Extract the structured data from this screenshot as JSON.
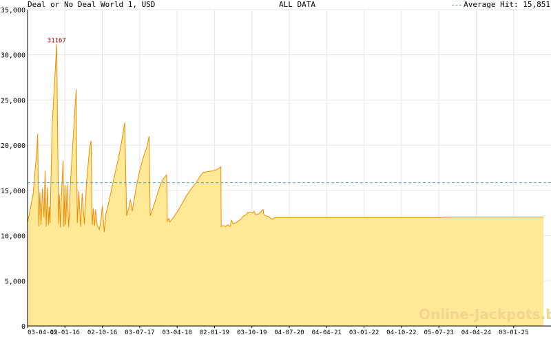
{
  "header": {
    "title": "Deal or No Deal World 1, USD",
    "range": "ALL DATA",
    "average_label": "Average Hit: 15,851"
  },
  "watermark": "Online-Jackpots.biz",
  "colors": {
    "line": "#f08c00",
    "fill": "#ffe896",
    "average_line": "#5aa0c8",
    "peak_label": "#b00000",
    "grid": "#e6e6e6"
  },
  "chart_data": {
    "type": "area",
    "title": "Deal or No Deal World 1, USD",
    "ylim": [
      0,
      35000
    ],
    "y_ticks": [
      0,
      5000,
      10000,
      15000,
      20000,
      25000,
      30000,
      35000
    ],
    "y_tick_labels": [
      "0",
      "5,000",
      "10,000",
      "15,000",
      "20,000",
      "25,000",
      "30,000",
      "35,000"
    ],
    "x_ticks": [
      "03-04-15",
      "02-01-16",
      "02-10-16",
      "03-07-17",
      "03-04-18",
      "02-01-19",
      "03-10-19",
      "04-07-20",
      "04-04-21",
      "03-01-22",
      "04-10-22",
      "05-07-23",
      "04-04-24",
      "03-01-25"
    ],
    "average": 15851,
    "peak": {
      "label": "31167",
      "value": 31167
    },
    "grid": true,
    "series": [
      {
        "points": [
          [
            0,
            11400
          ],
          [
            0.15,
            14600
          ],
          [
            0.25,
            19600
          ],
          [
            0.27,
            21300
          ],
          [
            0.3,
            11000
          ],
          [
            0.33,
            14800
          ],
          [
            0.36,
            11200
          ],
          [
            0.4,
            15200
          ],
          [
            0.44,
            12000
          ],
          [
            0.47,
            17200
          ],
          [
            0.5,
            11000
          ],
          [
            0.53,
            15300
          ],
          [
            0.56,
            11200
          ],
          [
            0.58,
            13200
          ],
          [
            0.6,
            11400
          ],
          [
            0.66,
            22300
          ],
          [
            0.72,
            26800
          ],
          [
            0.78,
            31167
          ],
          [
            0.83,
            11300
          ],
          [
            0.85,
            14600
          ],
          [
            0.88,
            10900
          ],
          [
            0.9,
            14000
          ],
          [
            0.95,
            18300
          ],
          [
            0.97,
            11000
          ],
          [
            1.0,
            15600
          ],
          [
            1.02,
            11200
          ],
          [
            1.06,
            15600
          ],
          [
            1.1,
            10900
          ],
          [
            1.12,
            12500
          ],
          [
            1.15,
            16000
          ],
          [
            1.25,
            22800
          ],
          [
            1.3,
            26200
          ],
          [
            1.33,
            11400
          ],
          [
            1.37,
            14900
          ],
          [
            1.42,
            11000
          ],
          [
            1.46,
            14700
          ],
          [
            1.52,
            11300
          ],
          [
            1.58,
            16000
          ],
          [
            1.66,
            19700
          ],
          [
            1.7,
            20500
          ],
          [
            1.73,
            11200
          ],
          [
            1.76,
            13000
          ],
          [
            1.79,
            11100
          ],
          [
            1.82,
            12900
          ],
          [
            1.86,
            11200
          ],
          [
            1.92,
            10700
          ],
          [
            1.96,
            11600
          ],
          [
            2.0,
            13300
          ],
          [
            2.05,
            10400
          ],
          [
            2.1,
            12500
          ],
          [
            2.18,
            13800
          ],
          [
            2.28,
            15800
          ],
          [
            2.4,
            18000
          ],
          [
            2.5,
            20000
          ],
          [
            2.6,
            22500
          ],
          [
            2.65,
            12200
          ],
          [
            2.7,
            13000
          ],
          [
            2.75,
            14000
          ],
          [
            2.8,
            12700
          ],
          [
            2.9,
            15200
          ],
          [
            3.0,
            17200
          ],
          [
            3.1,
            18700
          ],
          [
            3.2,
            19900
          ],
          [
            3.25,
            21000
          ],
          [
            3.28,
            12200
          ],
          [
            3.35,
            13000
          ],
          [
            3.45,
            14300
          ],
          [
            3.55,
            15600
          ],
          [
            3.65,
            16400
          ],
          [
            3.72,
            16700
          ],
          [
            3.74,
            11600
          ],
          [
            3.78,
            11900
          ],
          [
            3.8,
            11500
          ],
          [
            3.9,
            12000
          ],
          [
            4.0,
            12600
          ],
          [
            4.1,
            13300
          ],
          [
            4.25,
            14400
          ],
          [
            4.4,
            15300
          ],
          [
            4.55,
            16100
          ],
          [
            4.62,
            16600
          ],
          [
            4.7,
            17000
          ],
          [
            4.85,
            17100
          ],
          [
            5.0,
            17200
          ],
          [
            5.1,
            17400
          ],
          [
            5.17,
            17600
          ],
          [
            5.18,
            11000
          ],
          [
            5.25,
            11100
          ],
          [
            5.3,
            11000
          ],
          [
            5.35,
            11200
          ],
          [
            5.42,
            11000
          ],
          [
            5.45,
            11700
          ],
          [
            5.5,
            11300
          ],
          [
            5.6,
            11500
          ],
          [
            5.7,
            11800
          ],
          [
            5.78,
            12200
          ],
          [
            5.85,
            12300
          ],
          [
            5.9,
            12600
          ],
          [
            6.0,
            12500
          ],
          [
            6.06,
            12700
          ],
          [
            6.1,
            12300
          ],
          [
            6.18,
            12400
          ],
          [
            6.25,
            12700
          ],
          [
            6.3,
            12900
          ],
          [
            6.32,
            12300
          ],
          [
            6.38,
            12200
          ],
          [
            6.45,
            12100
          ],
          [
            6.5,
            11900
          ],
          [
            6.56,
            11800
          ],
          [
            6.6,
            12000
          ],
          [
            7.0,
            12000
          ],
          [
            8.0,
            12000
          ],
          [
            9.0,
            12000
          ],
          [
            10.0,
            12000
          ],
          [
            11.0,
            12000
          ],
          [
            11.2,
            12050
          ],
          [
            12.0,
            12050
          ],
          [
            13.0,
            12050
          ],
          [
            13.8,
            12050
          ]
        ]
      }
    ]
  }
}
